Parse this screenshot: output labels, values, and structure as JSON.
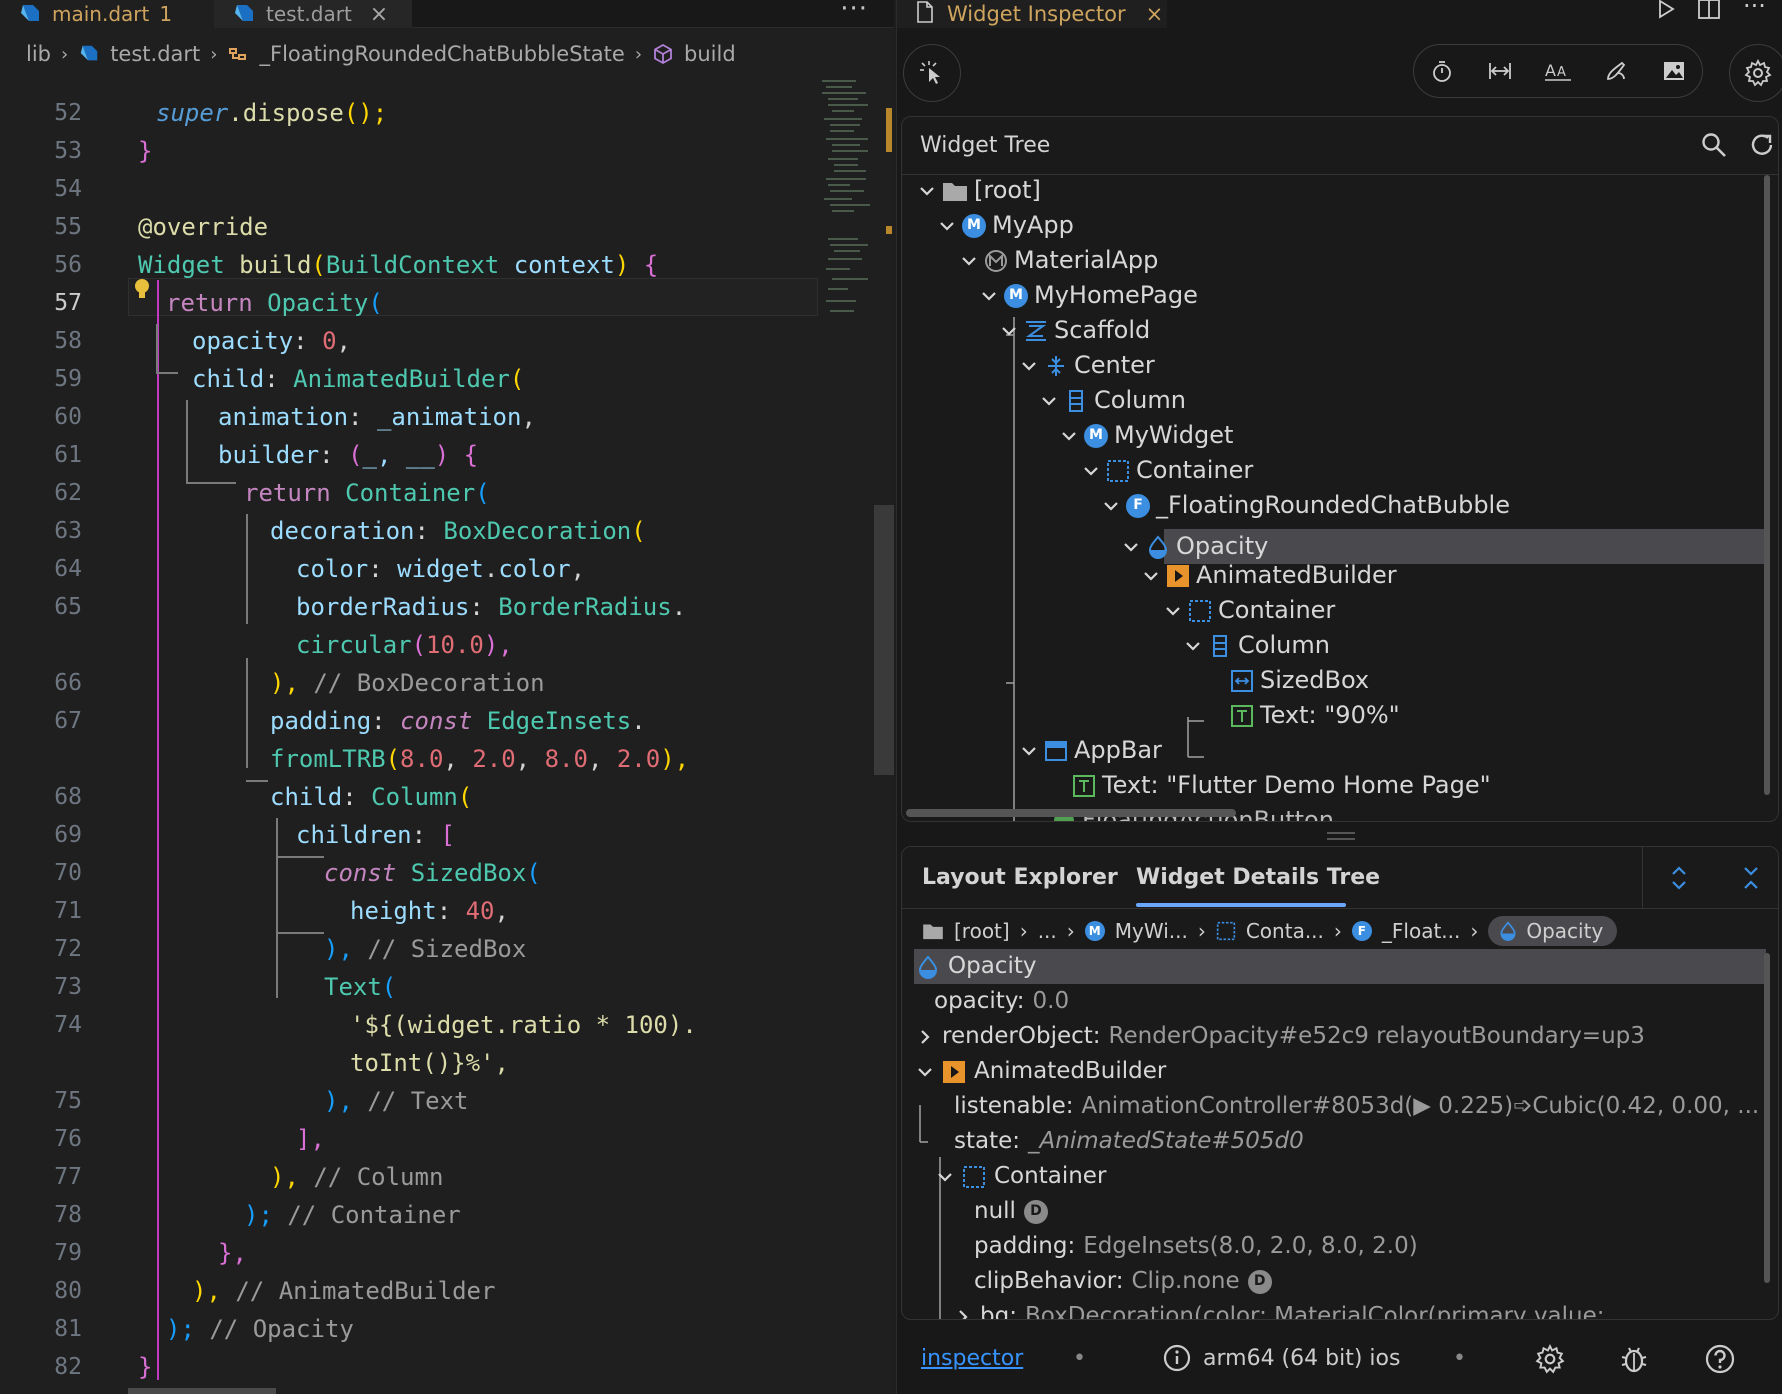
{
  "editor": {
    "tabs": [
      {
        "label": "main.dart",
        "badge": "1"
      },
      {
        "label": "test.dart",
        "close": "×"
      }
    ],
    "more": "···",
    "breadcrumb": [
      "lib",
      "test.dart",
      "_FloatingRoundedChatBubbleState",
      "build"
    ],
    "lines": [
      {
        "n": "52"
      },
      {
        "n": "53"
      },
      {
        "n": "54"
      },
      {
        "n": "55"
      },
      {
        "n": "56"
      },
      {
        "n": "57"
      },
      {
        "n": "58"
      },
      {
        "n": "59"
      },
      {
        "n": "60"
      },
      {
        "n": "61"
      },
      {
        "n": "62"
      },
      {
        "n": "63"
      },
      {
        "n": "64"
      },
      {
        "n": "65"
      },
      {
        "n": "66"
      },
      {
        "n": "67"
      },
      {
        "n": "68"
      },
      {
        "n": "69"
      },
      {
        "n": "70"
      },
      {
        "n": "71"
      },
      {
        "n": "72"
      },
      {
        "n": "73"
      },
      {
        "n": "74"
      },
      {
        "n": "75"
      },
      {
        "n": "76"
      },
      {
        "n": "77"
      },
      {
        "n": "78"
      },
      {
        "n": "79"
      },
      {
        "n": "80"
      },
      {
        "n": "81"
      },
      {
        "n": "82"
      }
    ],
    "code": {
      "l52": [
        "super",
        ".dispose",
        "();"
      ],
      "l53": "}",
      "l55": "@override",
      "l56": [
        "Widget",
        " build",
        "(",
        "BuildContext",
        " context",
        ")",
        " {"
      ],
      "l57": [
        "return ",
        "Opacity",
        "("
      ],
      "l58": [
        "opacity",
        ": ",
        "0",
        ","
      ],
      "l59": [
        "child",
        ": ",
        "AnimatedBuilder",
        "("
      ],
      "l60": [
        "animation",
        ": ",
        "_animation",
        ","
      ],
      "l61": [
        "builder",
        ": ",
        "(",
        "_, __",
        ")",
        " {"
      ],
      "l62": [
        "return ",
        "Container",
        "("
      ],
      "l63": [
        "decoration",
        ": ",
        "BoxDecoration",
        "("
      ],
      "l64": [
        "color",
        ": ",
        "widget",
        ".",
        "color",
        ","
      ],
      "l65a": [
        "borderRadius",
        ": ",
        "BorderRadius",
        "."
      ],
      "l65b": [
        "circular",
        "(",
        "10.0",
        "),"
      ],
      "l66": [
        "),",
        " // BoxDecoration"
      ],
      "l67a": [
        "padding",
        ": ",
        "const ",
        "EdgeInsets",
        "."
      ],
      "l67b": [
        "fromLTRB",
        "(",
        "8.0",
        ", ",
        "2.0",
        ", ",
        "8.0",
        ", ",
        "2.0",
        "),"
      ],
      "l68": [
        "child",
        ": ",
        "Column",
        "("
      ],
      "l69": [
        "children",
        ": ",
        "["
      ],
      "l70": [
        "const ",
        "SizedBox",
        "("
      ],
      "l71": [
        "height",
        ": ",
        "40",
        ","
      ],
      "l72": [
        "),",
        " // SizedBox"
      ],
      "l73": [
        "Text",
        "("
      ],
      "l74a": "'${(widget.ratio * 100).",
      "l74b": "toInt()}%',",
      "l75": [
        "),",
        " // Text"
      ],
      "l76": "],",
      "l77": [
        "),",
        " // Column"
      ],
      "l78": [
        ");",
        " // Container"
      ],
      "l79": "},",
      "l80": [
        "),",
        " // AnimatedBuilder"
      ],
      "l81": [
        ");",
        " // Opacity"
      ],
      "l82": "}"
    }
  },
  "inspector": {
    "tab": {
      "label": "Widget Inspector",
      "close": "×"
    },
    "tree": {
      "title": "Widget Tree",
      "nodes": [
        {
          "label": "[root]",
          "icon": "folder-icon"
        },
        {
          "label": "MyApp",
          "icon": "M"
        },
        {
          "label": "MaterialApp",
          "icon": "material-icon"
        },
        {
          "label": "MyHomePage",
          "icon": "M"
        },
        {
          "label": "Scaffold",
          "icon": "scaffold-icon"
        },
        {
          "label": "Center",
          "icon": "center-icon"
        },
        {
          "label": "Column",
          "icon": "column-icon"
        },
        {
          "label": "MyWidget",
          "icon": "M"
        },
        {
          "label": "Container",
          "icon": "container-icon"
        },
        {
          "label": "_FloatingRoundedChatBubble",
          "icon": "F"
        },
        {
          "label": "Opacity",
          "icon": "opacity-icon"
        },
        {
          "label": "AnimatedBuilder",
          "icon": "animated-icon"
        },
        {
          "label": "Container",
          "icon": "container-icon"
        },
        {
          "label": "Column",
          "icon": "column-icon"
        },
        {
          "label": "SizedBox",
          "icon": "sizedbox-icon"
        },
        {
          "label": "Text: \"90%\"",
          "icon": "text-icon"
        },
        {
          "label": "AppBar",
          "icon": "appbar-icon"
        },
        {
          "label": "Text: \"Flutter Demo Home Page\"",
          "icon": "text-icon"
        },
        {
          "label": "FloatingActionButton",
          "icon": "fab-icon"
        }
      ]
    },
    "details": {
      "tabs": [
        "Layout Explorer",
        "Widget Details Tree"
      ],
      "crumbs": [
        "[root]",
        "...",
        "MyWi...",
        "Conta...",
        "_Float...",
        "Opacity"
      ],
      "rows": [
        {
          "key": "Opacity"
        },
        {
          "key": "opacity:",
          "value": "0.0"
        },
        {
          "key": "renderObject:",
          "value": "RenderOpacity#e52c9 relayoutBoundary=up3"
        },
        {
          "key": "AnimatedBuilder"
        },
        {
          "key": "listenable:",
          "value": "AnimationController#8053d(▶ 0.225)➩Cubic(0.42, 0.00, ..."
        },
        {
          "key": "state:",
          "value": "_AnimatedState#505d0"
        },
        {
          "key": "Container"
        },
        {
          "key": "null",
          "badge": "D"
        },
        {
          "key": "padding:",
          "value": "EdgeInsets(8.0, 2.0, 8.0, 2.0)"
        },
        {
          "key": "clipBehavior:",
          "value": "Clip.none",
          "badge": "D"
        },
        {
          "key": "bg:",
          "value": "BoxDecoration(color: MaterialColor(primary value:"
        }
      ]
    },
    "status": {
      "link": "inspector",
      "sep": "•",
      "device": "arm64 (64 bit) ios"
    }
  }
}
